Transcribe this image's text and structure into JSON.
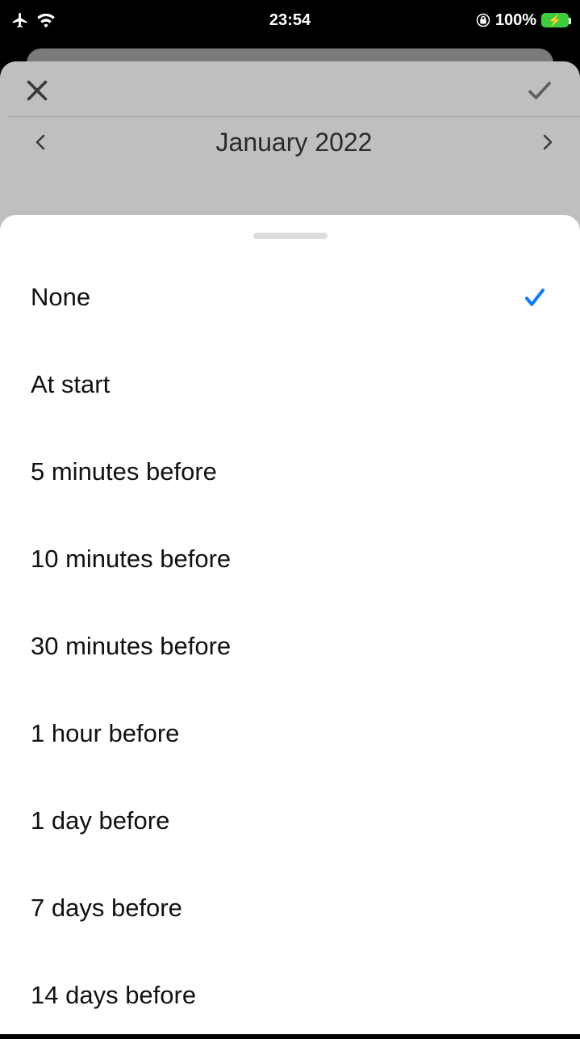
{
  "status": {
    "time": "23:54",
    "battery": "100%"
  },
  "header": {
    "title": "January 2022"
  },
  "options": [
    {
      "label": "None",
      "selected": true
    },
    {
      "label": "At start",
      "selected": false
    },
    {
      "label": "5 minutes before",
      "selected": false
    },
    {
      "label": "10 minutes before",
      "selected": false
    },
    {
      "label": "30 minutes before",
      "selected": false
    },
    {
      "label": "1 hour before",
      "selected": false
    },
    {
      "label": "1 day before",
      "selected": false
    },
    {
      "label": "7 days before",
      "selected": false
    },
    {
      "label": "14 days before",
      "selected": false
    }
  ]
}
